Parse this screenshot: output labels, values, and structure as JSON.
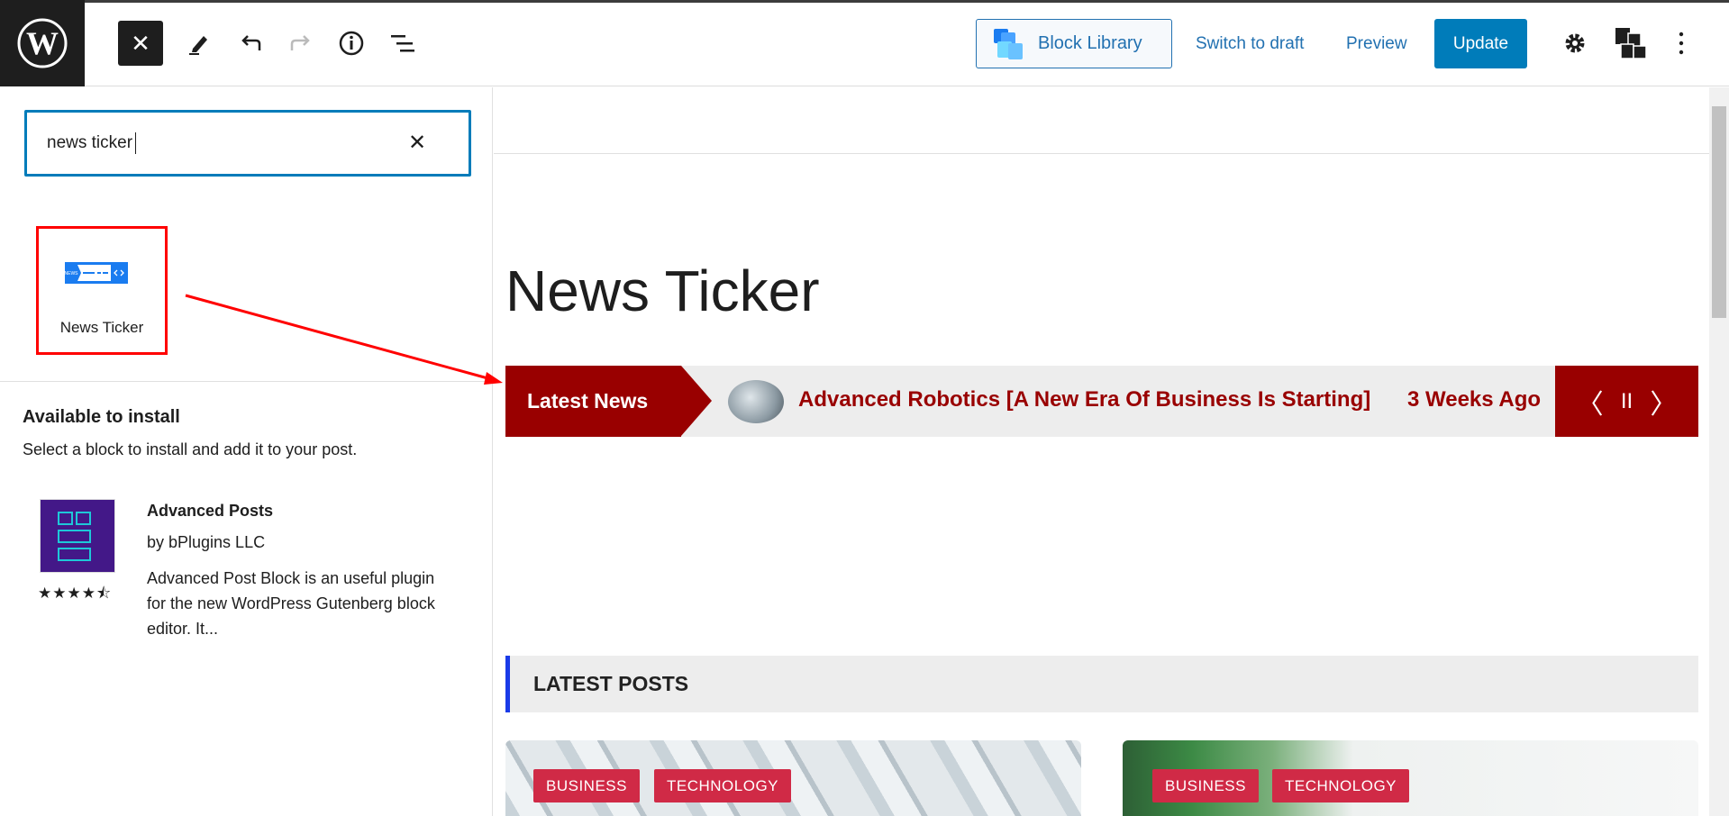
{
  "toolbar": {
    "close_icon": "close-icon",
    "block_library": "Block Library",
    "switch_to_draft": "Switch to draft",
    "preview": "Preview",
    "update": "Update"
  },
  "sidebar": {
    "search_value": "news ticker",
    "result_block": "News Ticker",
    "available_title": "Available to install",
    "available_subtitle": "Select a block to install and add it to your post.",
    "plugin": {
      "title": "Advanced Posts",
      "author": "by bPlugins LLC",
      "description": "Advanced Post Block is an useful plugin for the new WordPress Gutenberg block editor. It...",
      "rating": 4.5,
      "stars": "★★★★⯪"
    }
  },
  "editor": {
    "heading": "News Ticker",
    "ticker": {
      "label": "Latest News",
      "headline": "Advanced Robotics [A New Era Of Business Is Starting]",
      "time": "3 Weeks Ago",
      "prev": "〈",
      "pause": "II",
      "next": "〉"
    },
    "latest_posts": "LATEST POSTS",
    "cards": [
      {
        "tags": [
          "BUSINESS",
          "TECHNOLOGY"
        ]
      },
      {
        "tags": [
          "BUSINESS",
          "TECHNOLOGY"
        ]
      }
    ]
  },
  "colors": {
    "accent": "#007cba",
    "ticker": "#990000",
    "tag": "#d02a46",
    "annotation": "#ff0000"
  }
}
